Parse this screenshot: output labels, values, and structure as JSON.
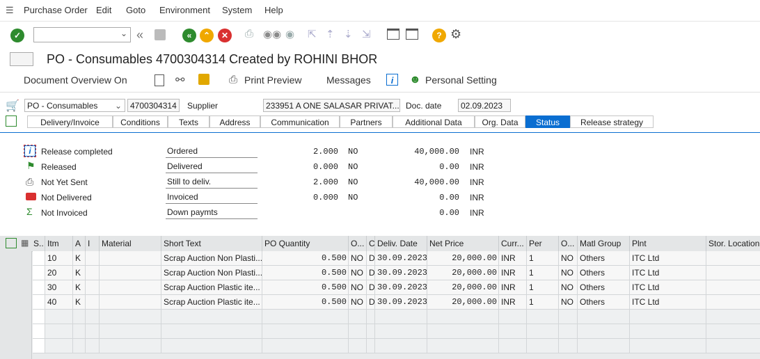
{
  "menubar": {
    "items": [
      "Purchase Order",
      "Edit",
      "Goto",
      "Environment",
      "System",
      "Help"
    ]
  },
  "toolbar": {
    "command_field_value": ""
  },
  "title": "PO - Consumables 4700304314 Created by ROHINI BHOR",
  "app_toolbar": {
    "document_overview": "Document Overview On",
    "print_preview": "Print Preview",
    "messages": "Messages",
    "personal_setting": "Personal Setting"
  },
  "header": {
    "doc_type": "PO - Consumables",
    "po_number": "4700304314",
    "supplier_label": "Supplier",
    "supplier_value": "233951 A ONE SALASAR PRIVAT...",
    "doc_date_label": "Doc. date",
    "doc_date_value": "02.09.2023"
  },
  "tabs": [
    "Delivery/Invoice",
    "Conditions",
    "Texts",
    "Address",
    "Communication",
    "Partners",
    "Additional Data",
    "Org. Data",
    "Status",
    "Release strategy"
  ],
  "active_tab": "Status",
  "status": {
    "left": [
      "Release completed",
      "Released",
      "Not Yet Sent",
      "Not Delivered",
      "Not Invoiced"
    ],
    "rows": [
      {
        "label": "Ordered",
        "qty": "2.000",
        "unit": "NO",
        "amount": "40,000.00",
        "curr": "INR"
      },
      {
        "label": "Delivered",
        "qty": "0.000",
        "unit": "NO",
        "amount": "0.00",
        "curr": "INR"
      },
      {
        "label": "Still to deliv.",
        "qty": "2.000",
        "unit": "NO",
        "amount": "40,000.00",
        "curr": "INR"
      },
      {
        "label": "Invoiced",
        "qty": "0.000",
        "unit": "NO",
        "amount": "0.00",
        "curr": "INR"
      },
      {
        "label": "Down paymts",
        "qty": "",
        "unit": "",
        "amount": "0.00",
        "curr": "INR"
      }
    ]
  },
  "grid": {
    "columns": [
      "S..",
      "Itm",
      "A",
      "I",
      "Material",
      "Short Text",
      "PO Quantity",
      "O...",
      "C",
      "Deliv. Date",
      "Net Price",
      "Curr...",
      "Per",
      "O...",
      "Matl Group",
      "Plnt",
      "Stor. Location"
    ],
    "rows": [
      {
        "itm": "10",
        "a": "K",
        "short_text": "Scrap Auction Non Plasti...",
        "qty": "0.500",
        "ou": "NO",
        "c": "D",
        "date": "30.09.2023",
        "price": "20,000.00",
        "curr": "INR",
        "per": "1",
        "opu": "NO",
        "matl_group": "Others",
        "plnt": "ITC Ltd"
      },
      {
        "itm": "20",
        "a": "K",
        "short_text": "Scrap Auction Non Plasti...",
        "qty": "0.500",
        "ou": "NO",
        "c": "D",
        "date": "30.09.2023",
        "price": "20,000.00",
        "curr": "INR",
        "per": "1",
        "opu": "NO",
        "matl_group": "Others",
        "plnt": "ITC Ltd"
      },
      {
        "itm": "30",
        "a": "K",
        "short_text": "Scrap Auction  Plastic ite...",
        "qty": "0.500",
        "ou": "NO",
        "c": "D",
        "date": "30.09.2023",
        "price": "20,000.00",
        "curr": "INR",
        "per": "1",
        "opu": "NO",
        "matl_group": "Others",
        "plnt": "ITC Ltd"
      },
      {
        "itm": "40",
        "a": "K",
        "short_text": "Scrap Auction  Plastic ite...",
        "qty": "0.500",
        "ou": "NO",
        "c": "D",
        "date": "30.09.2023",
        "price": "20,000.00",
        "curr": "INR",
        "per": "1",
        "opu": "NO",
        "matl_group": "Others",
        "plnt": "ITC Ltd"
      }
    ]
  },
  "colors": {
    "accent": "#0a6ed1",
    "green": "#2e8b2e",
    "orange": "#f0a800",
    "red": "#d93030"
  }
}
